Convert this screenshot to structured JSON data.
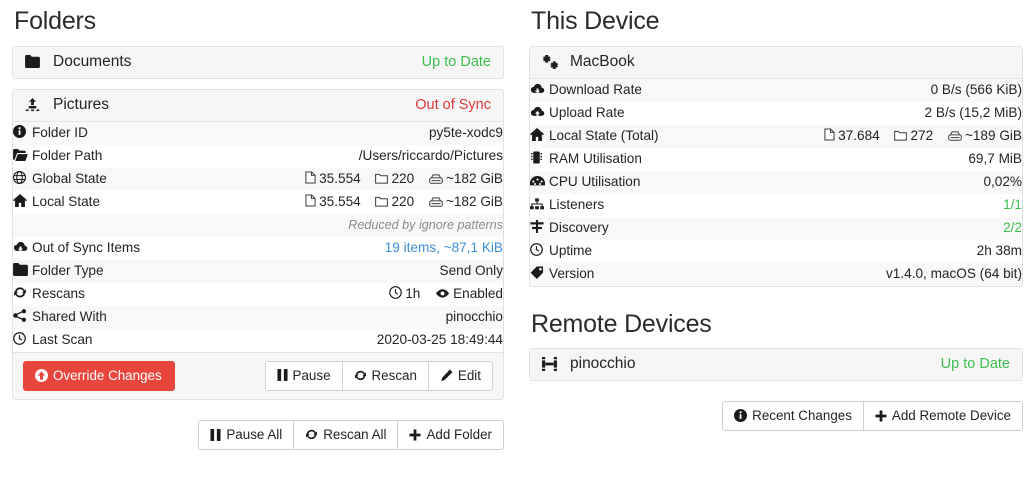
{
  "folders": {
    "title": "Folders",
    "items": [
      {
        "name": "Documents",
        "icon": "folder-icon",
        "status": "Up to Date",
        "status_color": "#3cbf4e",
        "expanded": false
      },
      {
        "name": "Pictures",
        "icon": "upload-icon",
        "status": "Out of Sync",
        "status_color": "#e0383a",
        "expanded": true,
        "details": [
          {
            "icon": "info-icon",
            "label": "Folder ID",
            "value": "py5te-xodc9"
          },
          {
            "icon": "folder-open-icon",
            "label": "Folder Path",
            "value": "/Users/riccardo/Pictures"
          },
          {
            "icon": "globe-icon",
            "label": "Global State",
            "metrics": [
              {
                "icon": "file-icon",
                "value": "35.554"
              },
              {
                "icon": "folder-icon",
                "value": "220"
              },
              {
                "icon": "hdd-icon",
                "value": "~182 GiB"
              }
            ]
          },
          {
            "icon": "home-icon",
            "label": "Local State",
            "metrics": [
              {
                "icon": "file-icon",
                "value": "35.554"
              },
              {
                "icon": "folder-icon",
                "value": "220"
              },
              {
                "icon": "hdd-icon",
                "value": "~182 GiB"
              }
            ]
          },
          {
            "icon": "",
            "label": "",
            "value": "Reduced by ignore patterns",
            "note": true
          },
          {
            "icon": "cloud-down-icon",
            "label": "Out of Sync Items",
            "value": "19 items, ~87,1 KiB",
            "link": true
          },
          {
            "icon": "folder-icon",
            "label": "Folder Type",
            "value": "Send Only"
          },
          {
            "icon": "refresh-icon",
            "label": "Rescans",
            "metrics": [
              {
                "icon": "clock-icon",
                "value": "1h"
              },
              {
                "icon": "eye-icon",
                "value": "Enabled"
              }
            ]
          },
          {
            "icon": "share-icon",
            "label": "Shared With",
            "value": "pinocchio"
          },
          {
            "icon": "clock-icon",
            "label": "Last Scan",
            "value": "2020-03-25 18:49:44"
          }
        ],
        "actions": {
          "override_label": "Override Changes",
          "override_icon": "arrow-up-circle-icon",
          "buttons": [
            {
              "icon": "pause-icon",
              "label": "Pause"
            },
            {
              "icon": "refresh-icon",
              "label": "Rescan"
            },
            {
              "icon": "pencil-icon",
              "label": "Edit"
            }
          ]
        }
      }
    ],
    "footer_buttons": [
      {
        "icon": "pause-icon",
        "label": "Pause All"
      },
      {
        "icon": "refresh-icon",
        "label": "Rescan All"
      },
      {
        "icon": "plus-icon",
        "label": "Add Folder"
      }
    ]
  },
  "this_device": {
    "title": "This Device",
    "device": {
      "name": "MacBook",
      "icon": "puzzle-icon"
    },
    "details": [
      {
        "icon": "cloud-down-icon",
        "label": "Download Rate",
        "value": "0 B/s (566 KiB)"
      },
      {
        "icon": "cloud-up-icon",
        "label": "Upload Rate",
        "value": "2 B/s (15,2 MiB)"
      },
      {
        "icon": "home-icon",
        "label": "Local State (Total)",
        "metrics": [
          {
            "icon": "file-icon",
            "value": "37.684"
          },
          {
            "icon": "folder-icon",
            "value": "272"
          },
          {
            "icon": "hdd-icon",
            "value": "~189 GiB"
          }
        ]
      },
      {
        "icon": "memory-icon",
        "label": "RAM Utilisation",
        "value": "69,7 MiB"
      },
      {
        "icon": "gauge-icon",
        "label": "CPU Utilisation",
        "value": "0,02%"
      },
      {
        "icon": "sitemap-icon",
        "label": "Listeners",
        "value": "1/1",
        "green": true
      },
      {
        "icon": "signpost-icon",
        "label": "Discovery",
        "value": "2/2",
        "green": true
      },
      {
        "icon": "clock-icon",
        "label": "Uptime",
        "value": "2h 38m"
      },
      {
        "icon": "tag-icon",
        "label": "Version",
        "value": "v1.4.0, macOS (64 bit)"
      }
    ]
  },
  "remote_devices": {
    "title": "Remote Devices",
    "items": [
      {
        "name": "pinocchio",
        "icon": "device-icon",
        "status": "Up to Date",
        "status_color": "#3cbf4e"
      }
    ],
    "footer_buttons": [
      {
        "icon": "info-icon",
        "label": "Recent Changes"
      },
      {
        "icon": "plus-icon",
        "label": "Add Remote Device"
      }
    ]
  }
}
